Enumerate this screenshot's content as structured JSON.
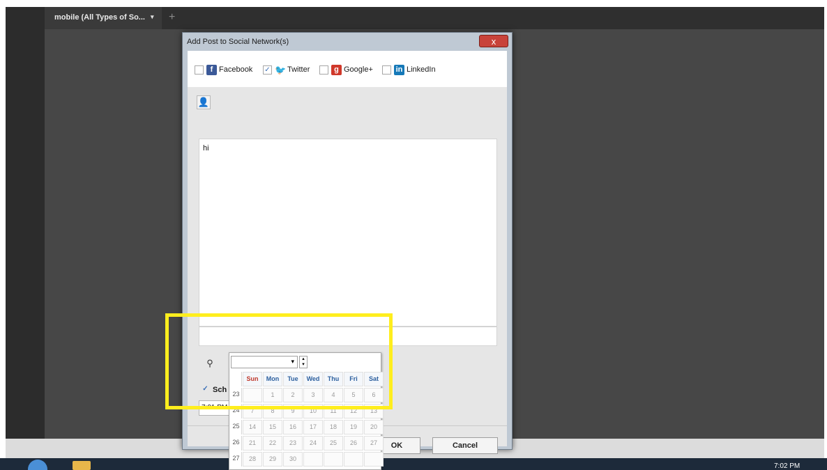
{
  "app": {
    "tab_label": "mobile (All Types of So...",
    "tab_caret": "▾",
    "tab_add": "+",
    "clock": "7:02 PM"
  },
  "dialog": {
    "title": "Add Post to Social Network(s)",
    "close_glyph": "x",
    "networks": [
      {
        "name": "Facebook",
        "checked": false,
        "icon": "facebook-icon"
      },
      {
        "name": "Twitter",
        "checked": true,
        "icon": "twitter-icon"
      },
      {
        "name": "Google+",
        "checked": false,
        "icon": "google-plus-icon"
      },
      {
        "name": "LinkedIn",
        "checked": false,
        "icon": "linkedin-icon"
      }
    ],
    "post_text": "hi",
    "schedule_label": "Sch",
    "schedule_checked": true,
    "time_value": "7:01 PM",
    "ok_label": "OK",
    "cancel_label": "Cancel",
    "accent_colors": {
      "highlight": "#ffee1e",
      "close": "#c8423a"
    }
  },
  "calendar": {
    "month_value": "",
    "day_headers": [
      "Sun",
      "Mon",
      "Tue",
      "Wed",
      "Thu",
      "Fri",
      "Sat"
    ],
    "weeks": [
      {
        "week": "23",
        "days": [
          "",
          "1",
          "2",
          "3",
          "4",
          "5",
          "6"
        ]
      },
      {
        "week": "24",
        "days": [
          "7",
          "8",
          "9",
          "10",
          "11",
          "12",
          "13"
        ]
      },
      {
        "week": "25",
        "days": [
          "14",
          "15",
          "16",
          "17",
          "18",
          "19",
          "20"
        ]
      },
      {
        "week": "26",
        "days": [
          "21",
          "22",
          "23",
          "24",
          "25",
          "26",
          "27"
        ]
      },
      {
        "week": "27",
        "days": [
          "28",
          "29",
          "30",
          "",
          "",
          "",
          ""
        ]
      }
    ]
  }
}
